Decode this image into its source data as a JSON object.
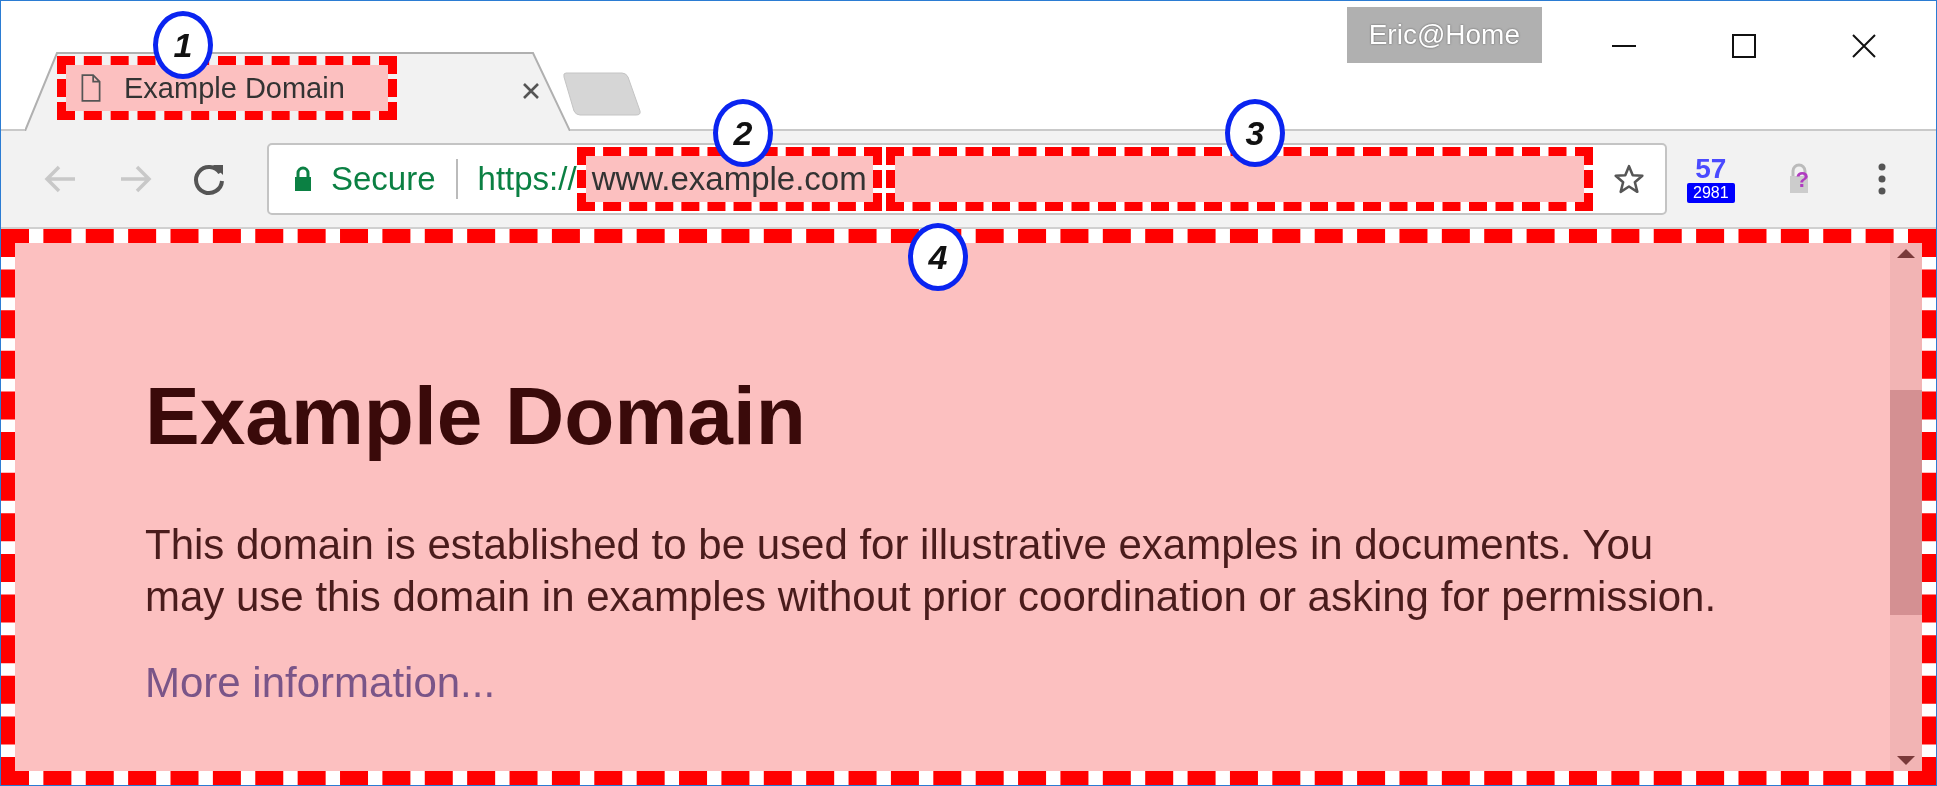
{
  "window": {
    "profile": "Eric@Home"
  },
  "tabs": [
    {
      "title": "Example Domain",
      "selected": true,
      "highlighted": true,
      "annotation": "1"
    }
  ],
  "toolbar": {
    "security": "Secure",
    "scheme": "https://",
    "host": "www.example.com",
    "host_highlighted": true,
    "host_annotation": "2",
    "rest_highlighted": true,
    "rest_annotation": "3",
    "extension_count": "57",
    "extension_badge": "2981",
    "lock_extension_glyph": "?"
  },
  "page": {
    "highlighted": true,
    "annotation": "4",
    "heading": "Example Domain",
    "paragraph": "This domain is established to be used for illustrative examples in documents. You may use this domain in examples without prior coordination or asking for permission.",
    "link": "More information..."
  }
}
